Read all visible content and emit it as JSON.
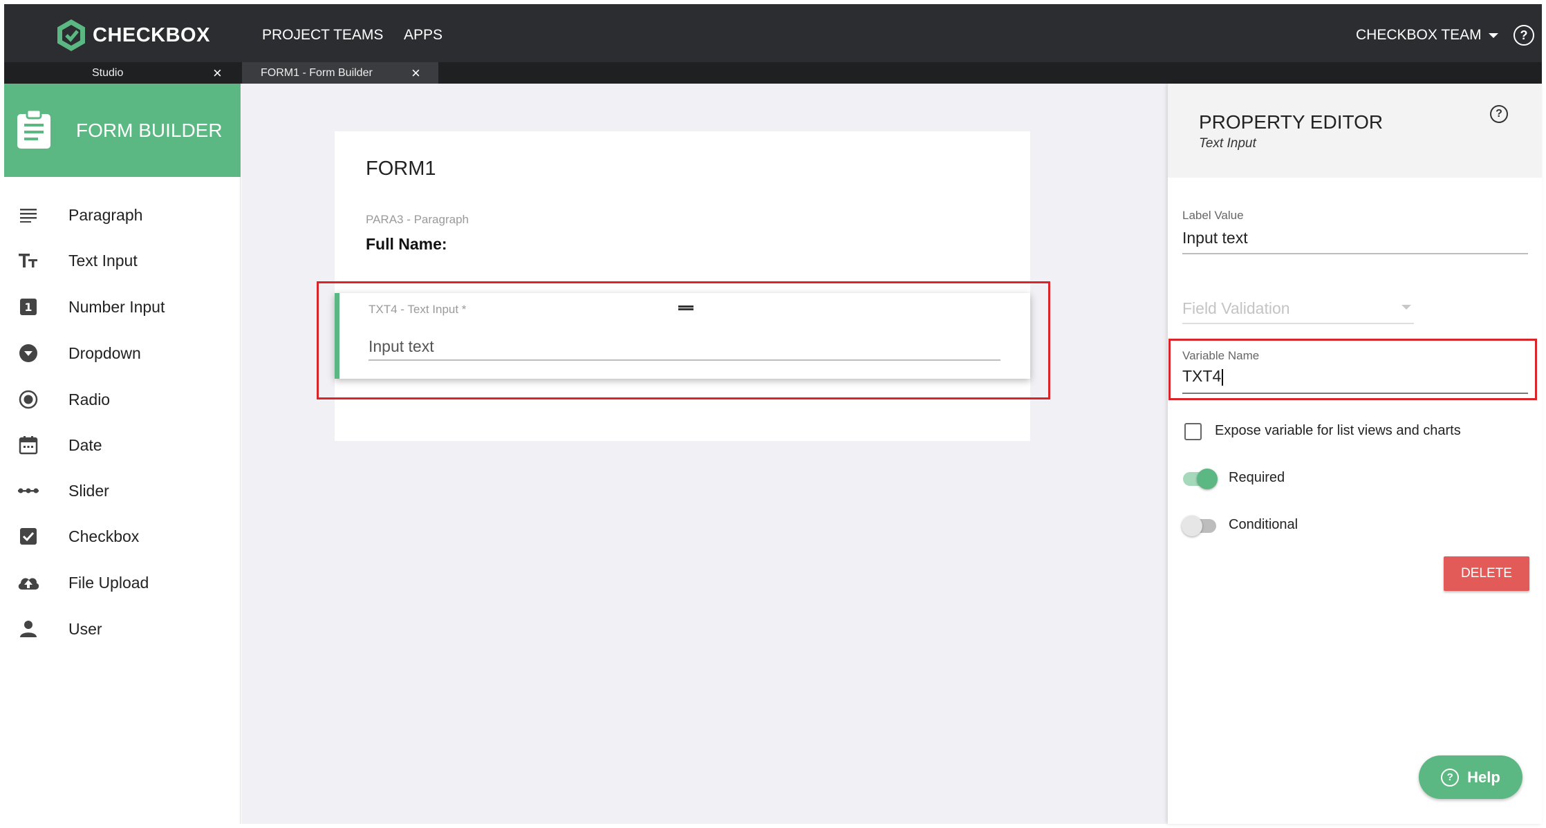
{
  "app": {
    "brand": "CHECKBOX",
    "nav": [
      "PROJECT TEAMS",
      "APPS"
    ],
    "team": "CHECKBOX TEAM",
    "help_glyph": "?"
  },
  "tabs": [
    {
      "label": "Studio",
      "close": "×"
    },
    {
      "label": "FORM1 - Form Builder",
      "close": "×"
    }
  ],
  "sidebar": {
    "title": "FORM BUILDER",
    "items": [
      {
        "label": "Paragraph",
        "icon": "paragraph-icon"
      },
      {
        "label": "Text Input",
        "icon": "text-size-icon"
      },
      {
        "label": "Number Input",
        "icon": "number-one-icon"
      },
      {
        "label": "Dropdown",
        "icon": "dropdown-icon"
      },
      {
        "label": "Radio",
        "icon": "radio-icon"
      },
      {
        "label": "Date",
        "icon": "calendar-icon"
      },
      {
        "label": "Slider",
        "icon": "slider-icon"
      },
      {
        "label": "Checkbox",
        "icon": "checkbox-icon"
      },
      {
        "label": "File Upload",
        "icon": "cloud-upload-icon"
      },
      {
        "label": "User",
        "icon": "person-icon"
      }
    ]
  },
  "form": {
    "title": "FORM1",
    "paragraph_caption": "PARA3 - Paragraph",
    "paragraph_text": "Full Name:",
    "field_caption": "TXT4 - Text Input *",
    "field_placeholder": "Input text"
  },
  "property_editor": {
    "title": "PROPERTY EDITOR",
    "subtitle": "Text Input",
    "label_value_caption": "Label Value",
    "label_value": "Input text",
    "field_validation_placeholder": "Field Validation",
    "variable_name_caption": "Variable Name",
    "variable_name": "TXT4",
    "expose_label": "Expose variable for list views and charts",
    "expose_checked": false,
    "required_label": "Required",
    "required_on": true,
    "conditional_label": "Conditional",
    "conditional_on": false,
    "delete_label": "DELETE"
  },
  "help_button": "Help",
  "colors": {
    "brand_green": "#5cb882",
    "topbar": "#2b2d30",
    "highlight_red": "#d9252a",
    "delete_red": "#e35b59"
  }
}
